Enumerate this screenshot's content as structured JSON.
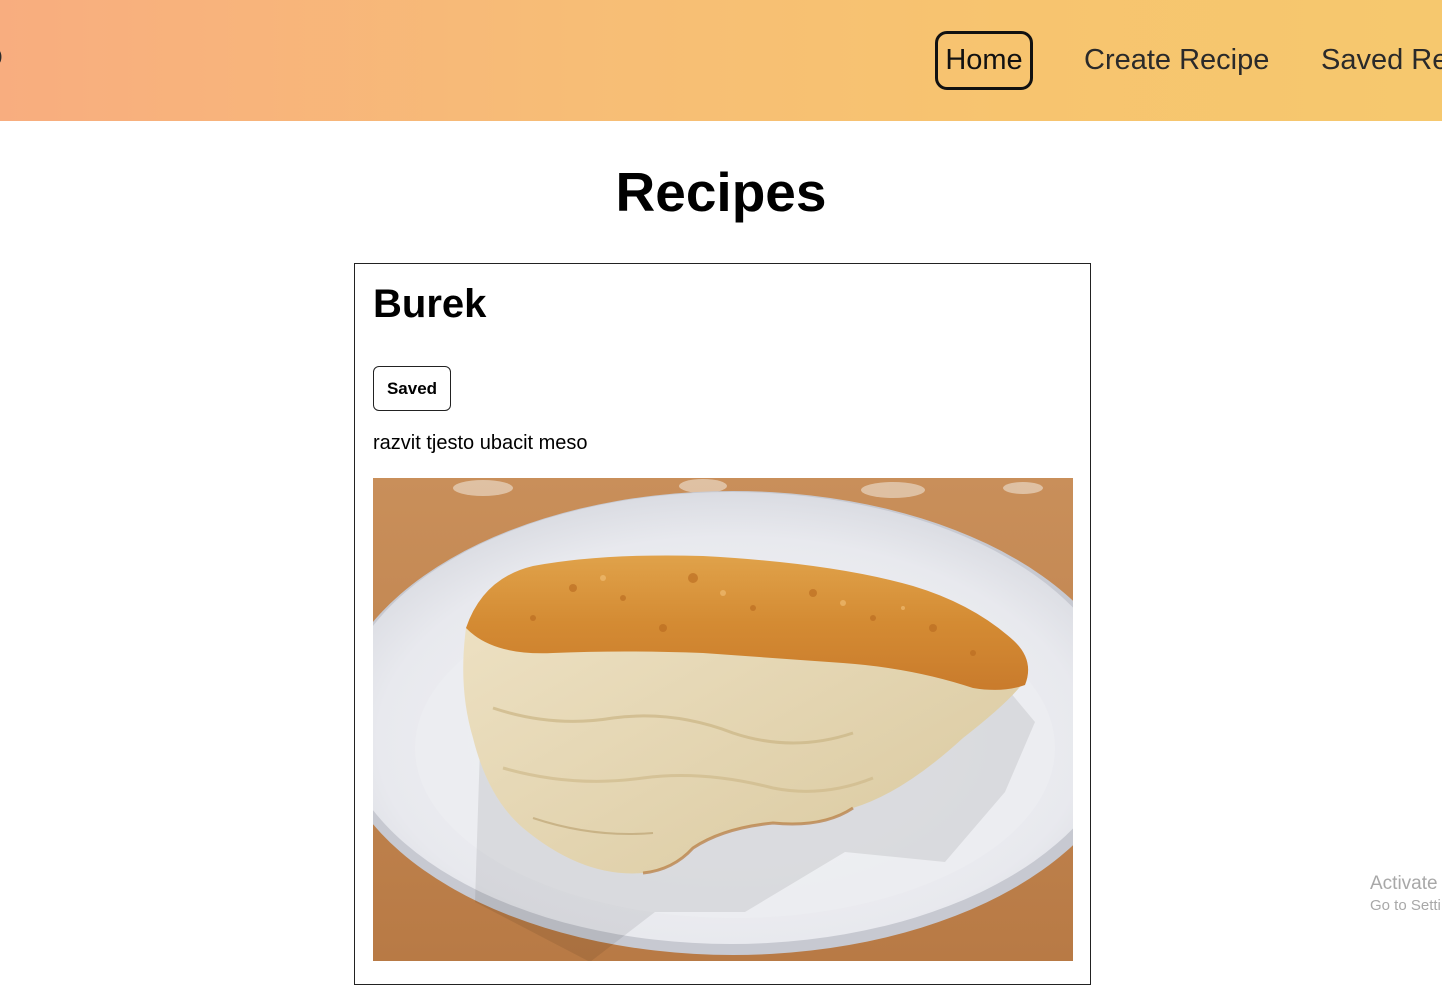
{
  "navbar": {
    "brand": "o",
    "links": [
      {
        "label": "Home",
        "active": true
      },
      {
        "label": "Create Recipe"
      },
      {
        "label": "Saved Re"
      }
    ],
    "gradient_colors": [
      "#f8ad7f",
      "#f6c86e"
    ]
  },
  "main": {
    "title": "Recipes"
  },
  "recipes": [
    {
      "name": "Burek",
      "saved_label": "Saved",
      "instructions": "razvit tjesto ubacit meso",
      "image": "photo of a slice of burek on a white plate"
    }
  ],
  "watermark": {
    "line1": "Activate",
    "line2": "Go to Setti"
  }
}
